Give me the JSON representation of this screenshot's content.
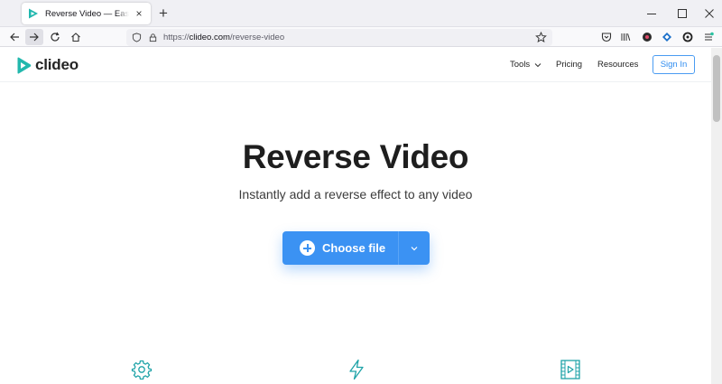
{
  "browser": {
    "tab": {
      "title": "Reverse Video — Easy-to-Use Online"
    },
    "url": {
      "scheme": "https://",
      "host": "clideo.com",
      "path": "/reverse-video"
    }
  },
  "site": {
    "logo_text": "clideo",
    "nav": {
      "tools": "Tools",
      "pricing": "Pricing",
      "resources": "Resources",
      "signin": "Sign In"
    }
  },
  "hero": {
    "title": "Reverse Video",
    "subtitle": "Instantly add a reverse effect to any video",
    "choose_file": "Choose file"
  },
  "features": {
    "icons": [
      "gear-icon",
      "lightning-icon",
      "video-frame-icon"
    ],
    "accent_color": "#1fa3a8"
  },
  "colors": {
    "primary": "#3b92f3",
    "brand_teal": "#1fb5ad"
  }
}
